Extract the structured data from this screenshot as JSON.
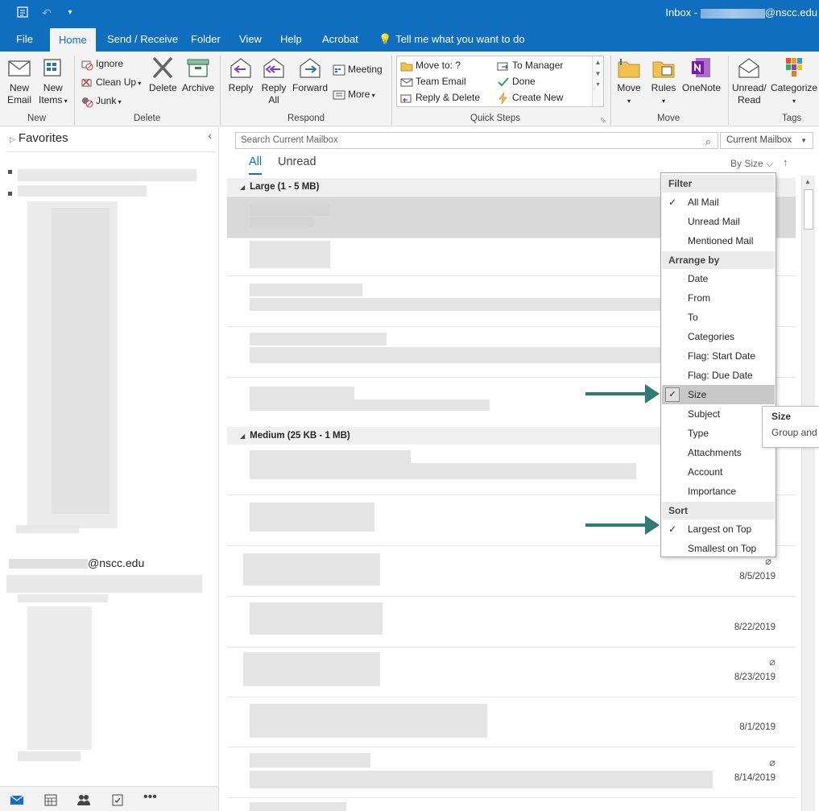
{
  "window": {
    "title_prefix": "Inbox - ",
    "title_suffix": "@nscc.edu"
  },
  "ribbon_tabs": [
    "File",
    "Home",
    "Send / Receive",
    "Folder",
    "View",
    "Help",
    "Acrobat"
  ],
  "tell_me": "Tell me what you want to do",
  "ribbon": {
    "new_email": "New Email",
    "new_email_l1": "New",
    "new_email_l2": "Email",
    "new_items_l1": "New",
    "new_items_l2": "Items",
    "group_new": "New",
    "ignore": "Ignore",
    "clean_up": "Clean Up",
    "junk": "Junk",
    "delete": "Delete",
    "archive": "Archive",
    "group_delete": "Delete",
    "reply": "Reply",
    "reply_all_l1": "Reply",
    "reply_all_l2": "All",
    "forward": "Forward",
    "meeting": "Meeting",
    "more": "More",
    "group_respond": "Respond",
    "qs_move_to": "Move to: ?",
    "qs_team_email": "Team Email",
    "qs_reply_delete": "Reply & Delete",
    "qs_to_manager": "To Manager",
    "qs_done": "Done",
    "qs_create_new": "Create New",
    "group_quick_steps": "Quick Steps",
    "move": "Move",
    "rules": "Rules",
    "onenote": "OneNote",
    "group_move": "Move",
    "unread_l1": "Unread/",
    "unread_l2": "Read",
    "categorize": "Categorize",
    "group_tags": "Tags"
  },
  "folder_pane": {
    "favorites": "Favorites",
    "account_email_suffix": "@nscc.edu"
  },
  "list": {
    "search_placeholder": "Search Current Mailbox",
    "scope": "Current Mailbox",
    "tab_all": "All",
    "tab_unread": "Unread",
    "arrange_label": "By Size",
    "groups": {
      "large": "Large (1 - 5 MB)",
      "medium": "Medium (25 KB - 1 MB)"
    },
    "rows": [
      {
        "date": ""
      },
      {
        "date": ""
      },
      {
        "date": ""
      },
      {
        "date": ""
      },
      {
        "date": ""
      },
      {
        "date": ""
      },
      {
        "date": ""
      },
      {
        "date": "8/5/2019"
      },
      {
        "date": "8/22/2019"
      },
      {
        "date": "8/23/2019"
      },
      {
        "date": "8/1/2019"
      },
      {
        "date": "8/14/2019"
      }
    ]
  },
  "menu": {
    "filter_header": "Filter",
    "all_mail": "All Mail",
    "unread_mail": "Unread Mail",
    "mentioned_mail": "Mentioned Mail",
    "arrange_header": "Arrange by",
    "date": "Date",
    "from": "From",
    "to": "To",
    "categories": "Categories",
    "flag_start": "Flag: Start Date",
    "flag_due": "Flag: Due Date",
    "size": "Size",
    "subject": "Subject",
    "type": "Type",
    "attachments": "Attachments",
    "account": "Account",
    "importance": "Importance",
    "sort_header": "Sort",
    "largest_on_top": "Largest on Top",
    "smallest_on_top": "Smallest on Top"
  },
  "tooltip": {
    "title": "Size",
    "body": "Group and"
  },
  "colors": {
    "accent": "#106ebe",
    "arrow": "#2f7c73"
  }
}
